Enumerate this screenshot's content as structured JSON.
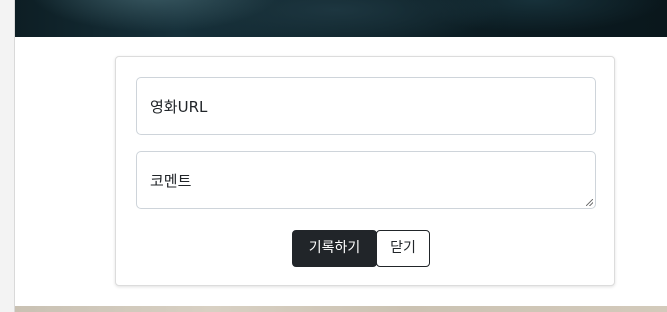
{
  "form": {
    "url_label": "영화URL",
    "comment_label": "코멘트"
  },
  "buttons": {
    "record_label": "기록하기",
    "close_label": "닫기"
  },
  "colors": {
    "button_dark": "#212529",
    "border": "#ced4da",
    "hero": "#0f242b"
  }
}
